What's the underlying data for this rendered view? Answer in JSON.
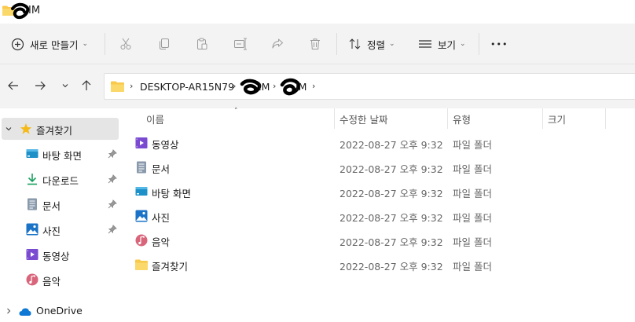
{
  "window": {
    "title": "IM"
  },
  "command_bar": {
    "new_label": "새로 만들기",
    "sort_label": "정렬",
    "view_label": "보기",
    "more_label": "•••",
    "icons": [
      "plus-circle-icon",
      "scissors-icon",
      "copy-icon",
      "paste-icon",
      "rename-icon",
      "share-icon",
      "trash-icon",
      "sort-icon",
      "view-icon",
      "more-icon"
    ]
  },
  "address_bar": {
    "crumbs": [
      "DESKTOP-AR15N79",
      "IM",
      "IM"
    ]
  },
  "sidebar": {
    "items": [
      {
        "label": "즐겨찾기",
        "icon": "star-icon"
      },
      {
        "label": "바탕 화면",
        "icon": "desktop-icon",
        "pinned": true
      },
      {
        "label": "다운로드",
        "icon": "download-icon",
        "pinned": true
      },
      {
        "label": "문서",
        "icon": "document-icon",
        "pinned": true
      },
      {
        "label": "사진",
        "icon": "picture-icon",
        "pinned": true
      },
      {
        "label": "동영상",
        "icon": "video-icon"
      },
      {
        "label": "음악",
        "icon": "music-icon"
      },
      {
        "label": "OneDrive",
        "icon": "cloud-icon"
      }
    ]
  },
  "file_list": {
    "columns": [
      "이름",
      "수정한 날짜",
      "유형",
      "크기"
    ],
    "rows": [
      {
        "name": "동영상",
        "date": "2022-08-27 오후 9:32",
        "type": "파일 폴더",
        "icon": "video-icon"
      },
      {
        "name": "문서",
        "date": "2022-08-27 오후 9:32",
        "type": "파일 폴더",
        "icon": "document-icon"
      },
      {
        "name": "바탕 화면",
        "date": "2022-08-27 오후 9:32",
        "type": "파일 폴더",
        "icon": "desktop-icon"
      },
      {
        "name": "사진",
        "date": "2022-08-27 오후 9:32",
        "type": "파일 폴더",
        "icon": "picture-icon"
      },
      {
        "name": "음악",
        "date": "2022-08-27 오후 9:32",
        "type": "파일 폴더",
        "icon": "music-icon"
      },
      {
        "name": "즐겨찾기",
        "date": "2022-08-27 오후 9:32",
        "type": "파일 폴더",
        "icon": "folder-icon"
      }
    ]
  },
  "colors": {
    "folder": "#f8c94b",
    "accent": "#0067c0",
    "selection": "#e5e5e5",
    "video": "#7a4bd1",
    "music": "#d9657a"
  }
}
